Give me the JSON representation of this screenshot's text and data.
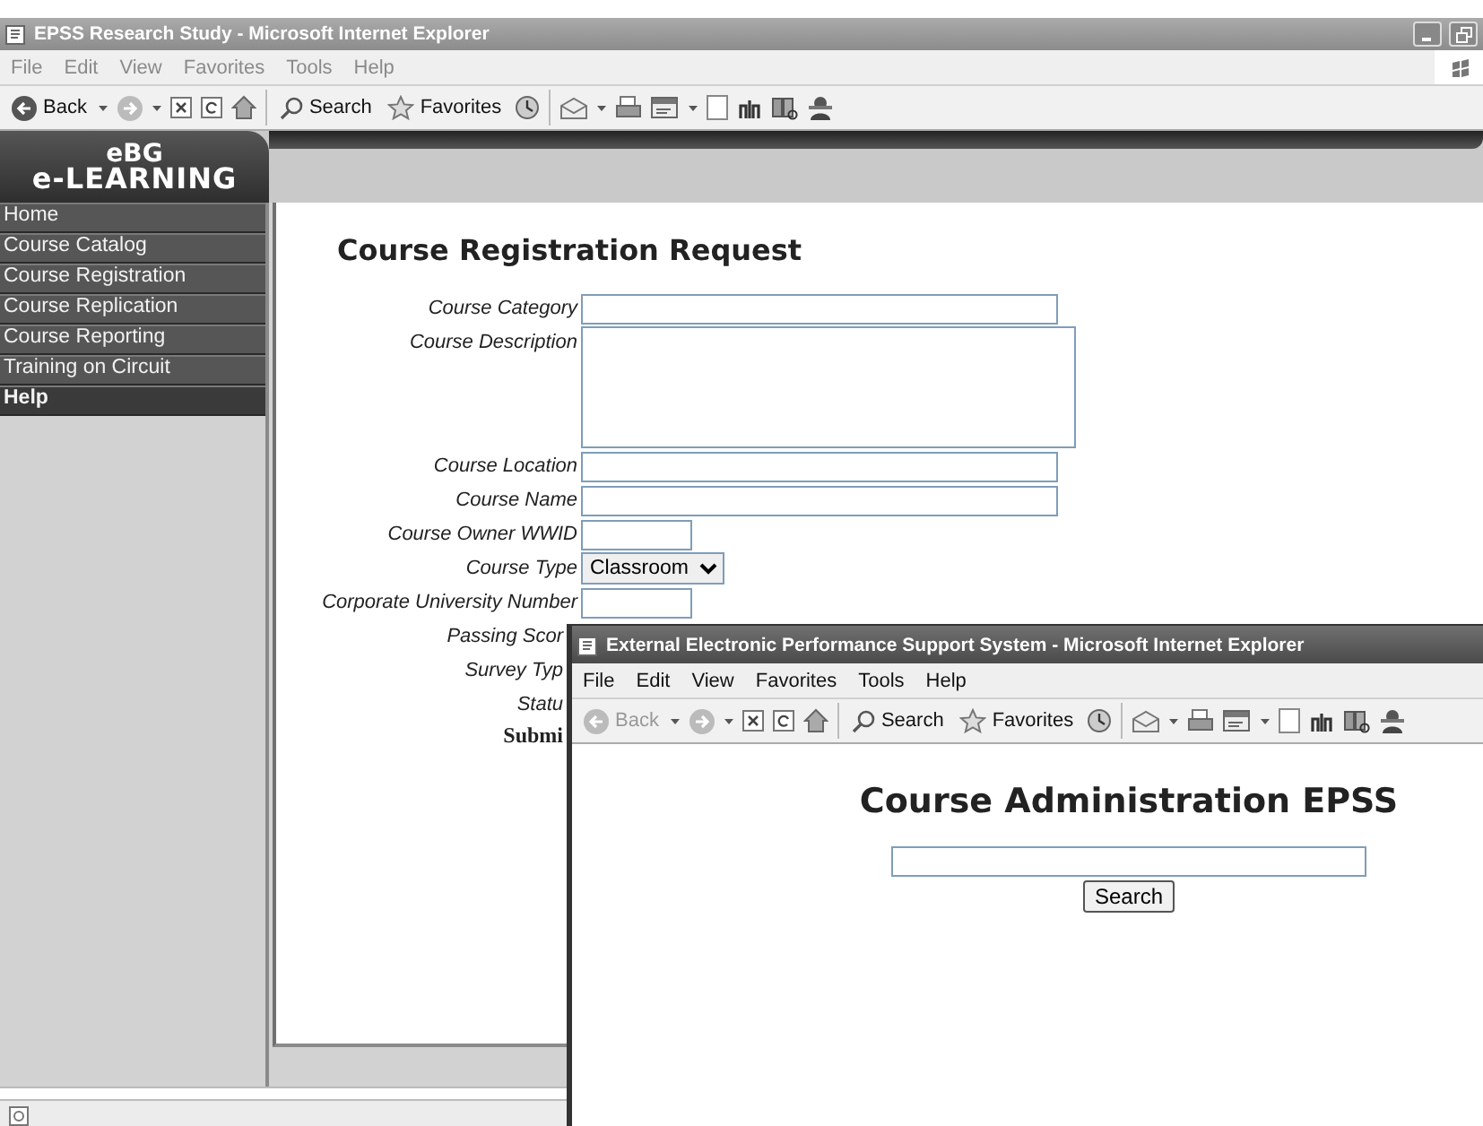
{
  "main_window": {
    "title": "EPSS Research Study - Microsoft Internet Explorer",
    "active": false,
    "menu": [
      "File",
      "Edit",
      "View",
      "Favorites",
      "Tools",
      "Help"
    ],
    "toolbar": {
      "back": {
        "label": "Back",
        "disabled": false
      },
      "search": "Search",
      "favorites": "Favorites"
    },
    "logo": {
      "line_1": "eBG",
      "line_2": "e-LEARNING"
    },
    "sidebar": {
      "items": [
        {
          "label": "Home",
          "selected": false
        },
        {
          "label": "Course Catalog",
          "selected": false
        },
        {
          "label": "Course Registration",
          "selected": false
        },
        {
          "label": "Course Replication",
          "selected": false
        },
        {
          "label": "Course Reporting",
          "selected": false
        },
        {
          "label": "Training on Circuit",
          "selected": false
        },
        {
          "label": "Help",
          "selected": true
        }
      ]
    },
    "form": {
      "title": "Course Registration Request",
      "rows": [
        {
          "label": "Course Category",
          "kind": "text"
        },
        {
          "label": "Course Description",
          "kind": "textarea"
        },
        {
          "label": "Course Location",
          "kind": "text"
        },
        {
          "label": "Course Name",
          "kind": "text"
        },
        {
          "label": "Course Owner WWID",
          "kind": "short"
        },
        {
          "label": "Course Type",
          "kind": "select",
          "value": "Classroom"
        },
        {
          "label": "Corporate University Number",
          "kind": "short"
        },
        {
          "label": "Passing Scor",
          "kind": "covered"
        },
        {
          "label": "Survey Typ",
          "kind": "covered"
        },
        {
          "label": "Statu",
          "kind": "covered"
        },
        {
          "label": "Submi",
          "kind": "submit"
        }
      ]
    }
  },
  "popup_window": {
    "title": "External Electronic Performance Support System - Microsoft Internet Explorer",
    "active": true,
    "menu": [
      "File",
      "Edit",
      "View",
      "Favorites",
      "Tools",
      "Help"
    ],
    "toolbar": {
      "back": {
        "label": "Back",
        "disabled": true
      },
      "search": "Search",
      "favorites": "Favorites"
    },
    "heading": "Course Administration EPSS",
    "search_button": "Search"
  }
}
